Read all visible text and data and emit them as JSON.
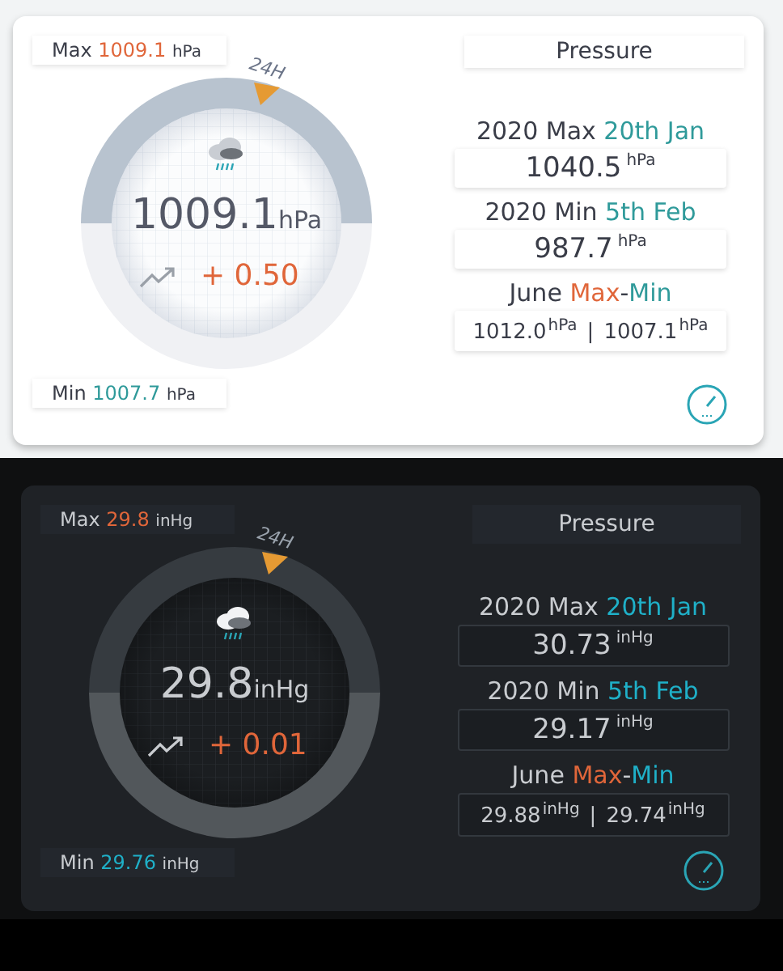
{
  "panels": [
    {
      "kind": "light",
      "max": {
        "label": "Max",
        "value": "1009.1",
        "unit": "hPa"
      },
      "min": {
        "label": "Min",
        "value": "1007.7",
        "unit": "hPa"
      },
      "ring_label": "24H",
      "current": {
        "value": "1009.1",
        "unit": "hPa"
      },
      "trend": "+ 0.50",
      "title": "Pressure",
      "records": [
        {
          "heading": [
            {
              "text": "2020 Max ",
              "kind": "plain"
            },
            {
              "text": "20th Jan",
              "kind": "cool"
            }
          ],
          "values": [
            {
              "value": "1040.5",
              "unit": "hPa"
            }
          ]
        },
        {
          "heading": [
            {
              "text": "2020 Min ",
              "kind": "plain"
            },
            {
              "text": "5th Feb",
              "kind": "cool"
            }
          ],
          "values": [
            {
              "value": "987.7",
              "unit": "hPa"
            }
          ]
        },
        {
          "heading": [
            {
              "text": "June ",
              "kind": "plain"
            },
            {
              "text": "Max",
              "kind": "warm"
            },
            {
              "text": "-",
              "kind": "plain"
            },
            {
              "text": "Min",
              "kind": "cool"
            }
          ],
          "values": [
            {
              "value": "1012.0",
              "unit": "hPa"
            },
            {
              "value": "1007.1",
              "unit": "hPa"
            }
          ],
          "separator": "|"
        }
      ]
    },
    {
      "kind": "dark",
      "max": {
        "label": "Max",
        "value": "29.8",
        "unit": "inHg"
      },
      "min": {
        "label": "Min",
        "value": "29.76",
        "unit": "inHg"
      },
      "ring_label": "24H",
      "current": {
        "value": "29.8",
        "unit": "inHg"
      },
      "trend": "+ 0.01",
      "title": "Pressure",
      "records": [
        {
          "heading": [
            {
              "text": "2020 Max ",
              "kind": "plain"
            },
            {
              "text": "20th Jan",
              "kind": "cool"
            }
          ],
          "values": [
            {
              "value": "30.73",
              "unit": "inHg"
            }
          ]
        },
        {
          "heading": [
            {
              "text": "2020 Min ",
              "kind": "plain"
            },
            {
              "text": "5th Feb",
              "kind": "cool"
            }
          ],
          "values": [
            {
              "value": "29.17",
              "unit": "inHg"
            }
          ]
        },
        {
          "heading": [
            {
              "text": "June ",
              "kind": "plain"
            },
            {
              "text": "Max",
              "kind": "warm"
            },
            {
              "text": "-",
              "kind": "plain"
            },
            {
              "text": "Min",
              "kind": "cool"
            }
          ],
          "values": [
            {
              "value": "29.88",
              "unit": "inHg"
            },
            {
              "value": "29.74",
              "unit": "inHg"
            }
          ],
          "separator": "|"
        }
      ]
    }
  ]
}
